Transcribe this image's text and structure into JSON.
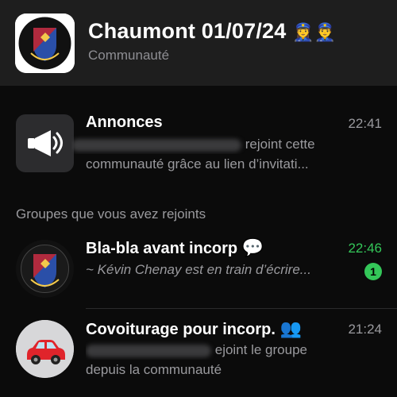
{
  "community": {
    "title": "Chaumont 01/07/24",
    "title_emojis": "👮‍♀️👮‍♂️",
    "subtitle": "Communauté",
    "avatar_icon": "school-crest-icon"
  },
  "announcements": {
    "title": "Annonces",
    "time": "22:41",
    "preview_line1_visible": "rejoint cette",
    "preview_line2": "communauté grâce au lien d’invitati..."
  },
  "groups_section_label": "Groupes que vous avez rejoints",
  "groups": [
    {
      "title": "Bla-bla avant incorp",
      "title_emoji": "💬",
      "time": "22:46",
      "time_color": "#34c759",
      "preview": "~ Kévin Chenay est en train d’écrire...",
      "unread": "1",
      "avatar_icon": "school-crest-icon"
    },
    {
      "title": "Covoiturage pour incorp.",
      "title_emoji": "👥",
      "time": "21:24",
      "preview_line1_visible": "ejoint le groupe",
      "preview_line2": "depuis la communauté",
      "avatar_icon": "red-car-icon"
    }
  ],
  "colors": {
    "background": "#0b0b0b",
    "header": "#1e1e1e",
    "accent_green": "#34c759",
    "secondary_text": "#9a9a9e"
  }
}
